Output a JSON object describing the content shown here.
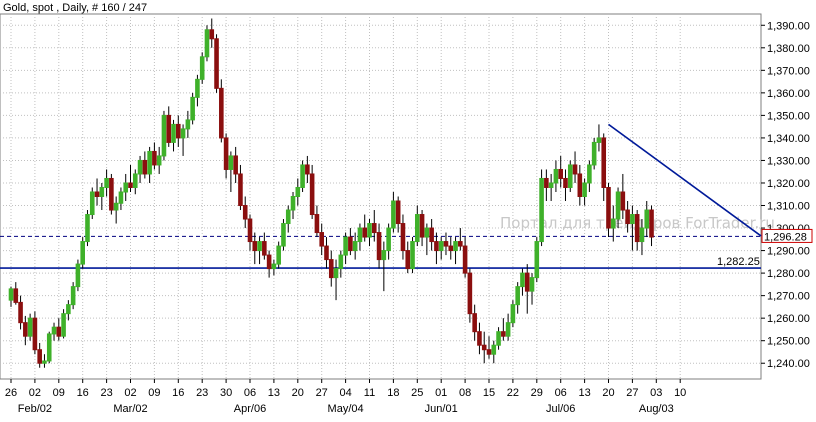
{
  "chart_data": {
    "type": "candlestick",
    "title": "Gold, spot , Daily, # 160 / 247",
    "watermark": "Портал для трейдеров ForTrader.ru",
    "ylim": [
      1233,
      1395
    ],
    "y_ticks": [
      "1,240.00",
      "1,250.00",
      "1,260.00",
      "1,270.00",
      "1,280.00",
      "1,290.00",
      "1,300.00",
      "1,310.00",
      "1,320.00",
      "1,330.00",
      "1,340.00",
      "1,350.00",
      "1,360.00",
      "1,370.00",
      "1,380.00",
      "1,390.00"
    ],
    "x_day_labels": [
      "26",
      "02",
      "09",
      "16",
      "23",
      "02",
      "09",
      "16",
      "23",
      "30",
      "06",
      "13",
      "20",
      "27",
      "04",
      "11",
      "18",
      "25",
      "01",
      "08",
      "15",
      "22",
      "29",
      "06",
      "13",
      "20",
      "27",
      "03",
      "10"
    ],
    "x_month_labels": [
      "Feb/02",
      "Mar/02",
      "Apr/06",
      "May/04",
      "Jun/01",
      "Jul/06",
      "Aug/03"
    ],
    "levels": {
      "current_price": "1,296.28",
      "support": "1,282.25"
    },
    "trendline": {
      "from_bar": 125,
      "from_price": 1346,
      "to_price": 1296.5
    },
    "colors": {
      "up": "#3fb12a",
      "down": "#8b0f0f",
      "line": "#001a99",
      "dash": "#000080",
      "grid": "#c0c0c0"
    },
    "candles": [
      [
        1268,
        1274,
        1265,
        1273
      ],
      [
        1273,
        1276,
        1266,
        1267
      ],
      [
        1267,
        1270,
        1255,
        1258
      ],
      [
        1258,
        1261,
        1248,
        1252
      ],
      [
        1252,
        1262,
        1250,
        1260
      ],
      [
        1260,
        1263,
        1244,
        1246
      ],
      [
        1246,
        1249,
        1238,
        1240
      ],
      [
        1240,
        1244,
        1238,
        1241
      ],
      [
        1241,
        1254,
        1240,
        1253
      ],
      [
        1253,
        1258,
        1250,
        1256
      ],
      [
        1256,
        1260,
        1250,
        1252
      ],
      [
        1252,
        1264,
        1251,
        1262
      ],
      [
        1262,
        1268,
        1259,
        1266
      ],
      [
        1266,
        1276,
        1264,
        1274
      ],
      [
        1274,
        1286,
        1272,
        1284
      ],
      [
        1284,
        1296,
        1282,
        1294
      ],
      [
        1294,
        1308,
        1292,
        1306
      ],
      [
        1306,
        1318,
        1304,
        1316
      ],
      [
        1316,
        1322,
        1310,
        1314
      ],
      [
        1314,
        1320,
        1308,
        1318
      ],
      [
        1318,
        1326,
        1314,
        1322
      ],
      [
        1322,
        1324,
        1306,
        1308
      ],
      [
        1308,
        1314,
        1302,
        1311
      ],
      [
        1311,
        1318,
        1308,
        1316
      ],
      [
        1316,
        1324,
        1312,
        1320
      ],
      [
        1320,
        1328,
        1316,
        1318
      ],
      [
        1318,
        1326,
        1315,
        1324
      ],
      [
        1324,
        1332,
        1320,
        1330
      ],
      [
        1330,
        1334,
        1322,
        1324
      ],
      [
        1324,
        1336,
        1320,
        1334
      ],
      [
        1334,
        1338,
        1326,
        1328
      ],
      [
        1328,
        1336,
        1324,
        1332
      ],
      [
        1332,
        1352,
        1330,
        1350
      ],
      [
        1350,
        1354,
        1336,
        1338
      ],
      [
        1338,
        1348,
        1334,
        1346
      ],
      [
        1346,
        1350,
        1336,
        1340
      ],
      [
        1340,
        1346,
        1332,
        1344
      ],
      [
        1344,
        1352,
        1340,
        1348
      ],
      [
        1348,
        1360,
        1346,
        1358
      ],
      [
        1358,
        1368,
        1354,
        1366
      ],
      [
        1366,
        1378,
        1364,
        1376
      ],
      [
        1376,
        1390,
        1374,
        1388
      ],
      [
        1388,
        1393,
        1380,
        1384
      ],
      [
        1384,
        1386,
        1360,
        1362
      ],
      [
        1362,
        1366,
        1338,
        1340
      ],
      [
        1340,
        1342,
        1322,
        1326
      ],
      [
        1326,
        1334,
        1316,
        1332
      ],
      [
        1332,
        1336,
        1320,
        1324
      ],
      [
        1324,
        1328,
        1308,
        1310
      ],
      [
        1310,
        1314,
        1300,
        1304
      ],
      [
        1304,
        1306,
        1290,
        1294
      ],
      [
        1294,
        1298,
        1284,
        1290
      ],
      [
        1290,
        1296,
        1284,
        1294
      ],
      [
        1294,
        1298,
        1286,
        1288
      ],
      [
        1288,
        1290,
        1278,
        1282
      ],
      [
        1282,
        1286,
        1279,
        1284
      ],
      [
        1284,
        1294,
        1282,
        1292
      ],
      [
        1292,
        1304,
        1290,
        1302
      ],
      [
        1302,
        1310,
        1298,
        1308
      ],
      [
        1308,
        1316,
        1304,
        1314
      ],
      [
        1314,
        1322,
        1310,
        1318
      ],
      [
        1318,
        1330,
        1316,
        1328
      ],
      [
        1328,
        1332,
        1320,
        1324
      ],
      [
        1324,
        1328,
        1304,
        1306
      ],
      [
        1306,
        1310,
        1296,
        1298
      ],
      [
        1298,
        1302,
        1288,
        1292
      ],
      [
        1292,
        1296,
        1282,
        1286
      ],
      [
        1286,
        1290,
        1274,
        1278
      ],
      [
        1278,
        1286,
        1268,
        1282
      ],
      [
        1282,
        1290,
        1278,
        1288
      ],
      [
        1288,
        1298,
        1284,
        1296
      ],
      [
        1296,
        1300,
        1288,
        1290
      ],
      [
        1290,
        1298,
        1286,
        1294
      ],
      [
        1294,
        1302,
        1290,
        1300
      ],
      [
        1300,
        1306,
        1294,
        1296
      ],
      [
        1296,
        1304,
        1292,
        1302
      ],
      [
        1302,
        1308,
        1294,
        1298
      ],
      [
        1298,
        1302,
        1282,
        1286
      ],
      [
        1286,
        1294,
        1272,
        1290
      ],
      [
        1290,
        1302,
        1286,
        1300
      ],
      [
        1300,
        1316,
        1298,
        1312
      ],
      [
        1312,
        1314,
        1298,
        1302
      ],
      [
        1302,
        1306,
        1286,
        1290
      ],
      [
        1290,
        1294,
        1280,
        1282
      ],
      [
        1282,
        1296,
        1280,
        1294
      ],
      [
        1294,
        1310,
        1292,
        1306
      ],
      [
        1306,
        1308,
        1292,
        1296
      ],
      [
        1296,
        1302,
        1288,
        1300
      ],
      [
        1300,
        1304,
        1290,
        1294
      ],
      [
        1294,
        1298,
        1284,
        1290
      ],
      [
        1290,
        1296,
        1286,
        1294
      ],
      [
        1294,
        1298,
        1288,
        1292
      ],
      [
        1292,
        1296,
        1286,
        1290
      ],
      [
        1290,
        1296,
        1284,
        1294
      ],
      [
        1294,
        1300,
        1290,
        1292
      ],
      [
        1292,
        1296,
        1278,
        1280
      ],
      [
        1280,
        1282,
        1258,
        1262
      ],
      [
        1262,
        1266,
        1250,
        1254
      ],
      [
        1254,
        1258,
        1244,
        1248
      ],
      [
        1248,
        1254,
        1240,
        1246
      ],
      [
        1246,
        1252,
        1242,
        1244
      ],
      [
        1244,
        1250,
        1240,
        1248
      ],
      [
        1248,
        1256,
        1246,
        1254
      ],
      [
        1254,
        1260,
        1250,
        1252
      ],
      [
        1252,
        1262,
        1250,
        1258
      ],
      [
        1258,
        1268,
        1256,
        1266
      ],
      [
        1266,
        1276,
        1262,
        1274
      ],
      [
        1274,
        1282,
        1270,
        1280
      ],
      [
        1280,
        1284,
        1262,
        1272
      ],
      [
        1272,
        1280,
        1266,
        1278
      ],
      [
        1278,
        1296,
        1276,
        1294
      ],
      [
        1294,
        1326,
        1292,
        1322
      ],
      [
        1322,
        1326,
        1312,
        1318
      ],
      [
        1318,
        1324,
        1312,
        1320
      ],
      [
        1320,
        1330,
        1316,
        1326
      ],
      [
        1326,
        1332,
        1318,
        1322
      ],
      [
        1322,
        1326,
        1312,
        1318
      ],
      [
        1318,
        1330,
        1316,
        1328
      ],
      [
        1328,
        1334,
        1320,
        1324
      ],
      [
        1324,
        1328,
        1310,
        1314
      ],
      [
        1314,
        1322,
        1310,
        1320
      ],
      [
        1320,
        1330,
        1316,
        1328
      ],
      [
        1328,
        1340,
        1326,
        1338
      ],
      [
        1338,
        1346,
        1334,
        1340
      ],
      [
        1340,
        1342,
        1312,
        1318
      ],
      [
        1318,
        1320,
        1296,
        1300
      ],
      [
        1300,
        1310,
        1294,
        1304
      ],
      [
        1304,
        1318,
        1300,
        1316
      ],
      [
        1316,
        1324,
        1304,
        1308
      ],
      [
        1308,
        1312,
        1298,
        1302
      ],
      [
        1302,
        1310,
        1290,
        1306
      ],
      [
        1306,
        1308,
        1290,
        1294
      ],
      [
        1294,
        1304,
        1288,
        1300
      ],
      [
        1300,
        1312,
        1296,
        1308
      ],
      [
        1308,
        1310,
        1292,
        1296
      ]
    ]
  }
}
